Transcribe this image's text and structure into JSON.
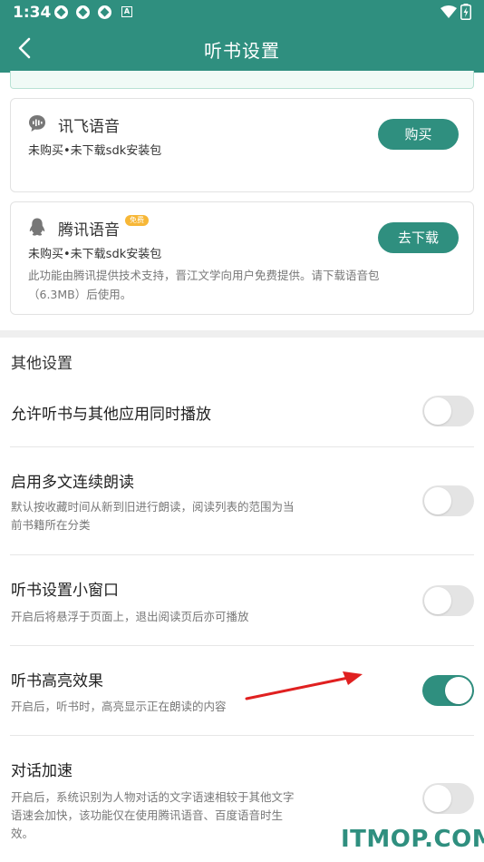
{
  "status_bar": {
    "time": "1:34",
    "notification_letter": "A"
  },
  "header": {
    "title": "听书设置"
  },
  "voice_engines": [
    {
      "name": "讯飞语音",
      "status": "未购买•未下载sdk安装包",
      "button": "购买"
    },
    {
      "name": "腾讯语音",
      "badge": "免费",
      "status": "未购买•未下载sdk安装包",
      "description": "此功能由腾讯提供技术支持，晋江文学向用户免费提供。请下载语音包（6.3MB）后使用。",
      "button": "去下载"
    }
  ],
  "other_settings": {
    "section_title": "其他设置",
    "items": [
      {
        "title": "允许听书与其他应用同时播放",
        "desc": "",
        "enabled": false
      },
      {
        "title": "启用多文连续朗读",
        "desc": "默认按收藏时间从新到旧进行朗读，阅读列表的范围为当前书籍所在分类",
        "enabled": false
      },
      {
        "title": "听书设置小窗口",
        "desc": "开启后将悬浮于页面上，退出阅读页后亦可播放",
        "enabled": false
      },
      {
        "title": "听书高亮效果",
        "desc": "开启后，听书时，高亮显示正在朗读的内容",
        "enabled": true
      },
      {
        "title": "对话加速",
        "desc": "开启后，系统识别为人物对话的文字语速相较于其他文字语速会加快，该功能仅在使用腾讯语音、百度语音时生效。",
        "enabled": false
      }
    ]
  },
  "watermark": "ITMOP.COM",
  "colors": {
    "accent": "#2f8f7f",
    "badge": "#f7b737",
    "annotation_arrow": "#e02020"
  }
}
